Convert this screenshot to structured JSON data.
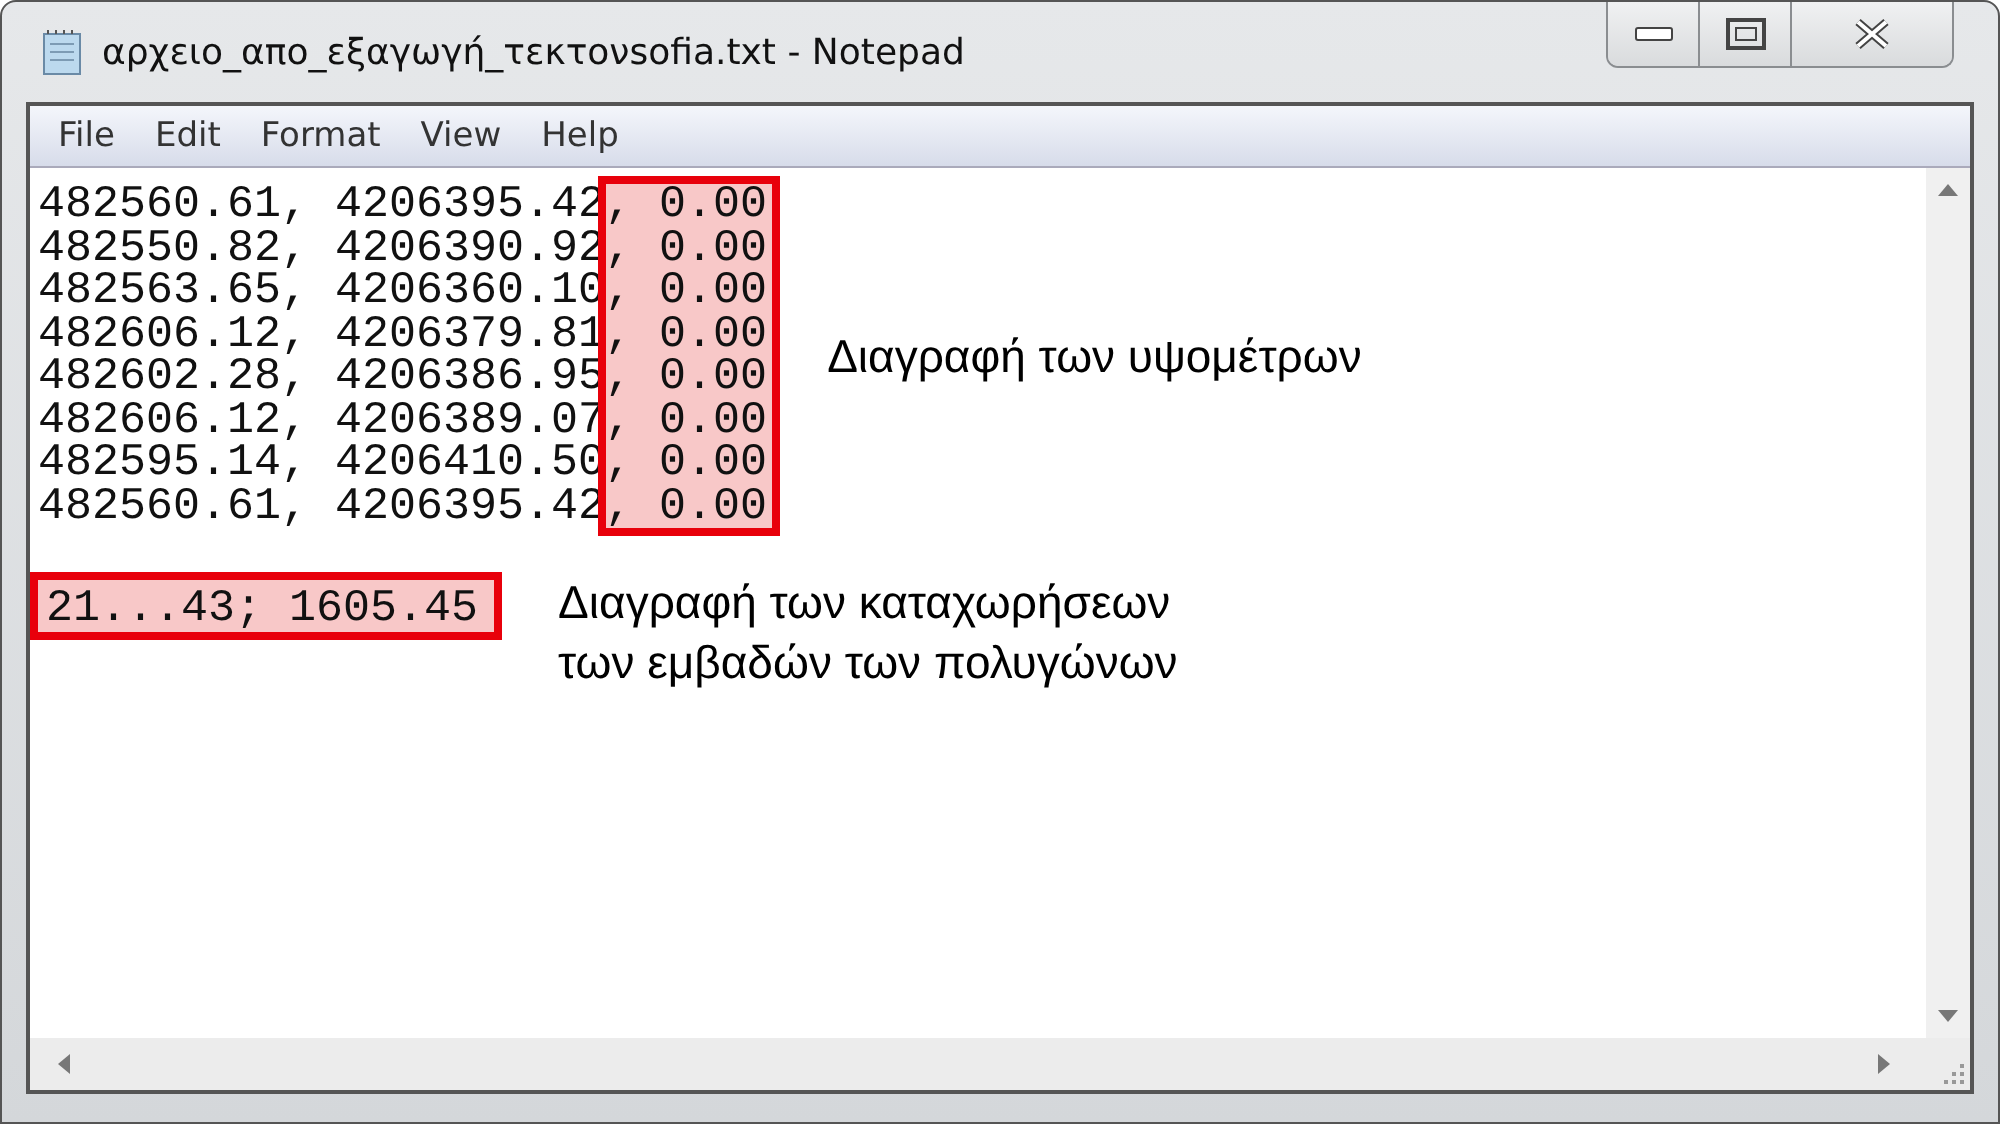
{
  "window": {
    "title": "αρχειο_απο_εξαγωγή_τεκτονsofia.txt - Notepad"
  },
  "menu": [
    "File",
    "Edit",
    "Format",
    "View",
    "Help"
  ],
  "points": {
    "marked": true,
    "note": "Διαγραφή των υψομέτρων",
    "rows": [
      {
        "coords": "482560.61, 4206395.42",
        "elevation": ", 0.00"
      },
      {
        "coords": "482550.82, 4206390.92",
        "elevation": ", 0.00"
      },
      {
        "coords": "482563.65, 4206360.10",
        "elevation": ", 0.00"
      },
      {
        "coords": "482606.12, 4206379.81",
        "elevation": ", 0.00"
      },
      {
        "coords": "482602.28, 4206386.95",
        "elevation": ", 0.00"
      },
      {
        "coords": "482606.12, 4206389.07",
        "elevation": ", 0.00"
      },
      {
        "coords": "482595.14, 4206410.50",
        "elevation": ", 0.00"
      },
      {
        "coords": "482560.61, 4206395.42",
        "elevation": ", 0.00"
      }
    ]
  },
  "area": {
    "marked": true,
    "text": "21...43; 1605.45",
    "note": "Διαγραφή των καταχωρήσεων\nτων εμβαδών των πολυγώνων"
  }
}
